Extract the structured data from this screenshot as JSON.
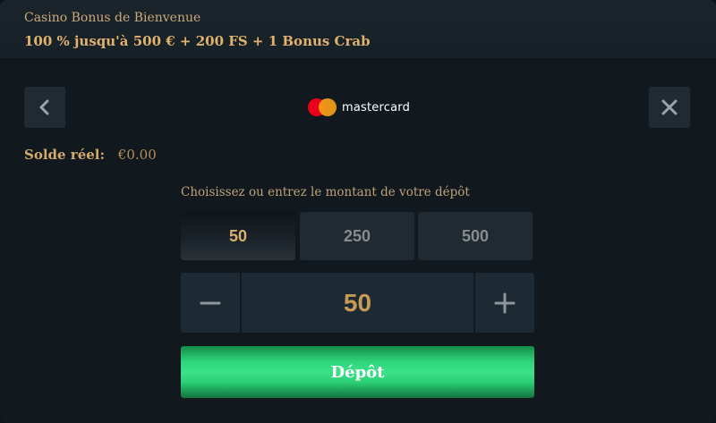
{
  "header": {
    "subtitle": "Casino Bonus de Bienvenue",
    "title": "100 % jusqu'à 500 € + 200 FS + 1 Bonus Crab"
  },
  "nav": {
    "back_icon": "chevron-left-icon",
    "close_icon": "close-icon"
  },
  "provider": {
    "name": "mastercard",
    "logo_icon": "mastercard-logo",
    "colors": {
      "red": "#eb001b",
      "orange": "#f79e1b"
    }
  },
  "balance": {
    "label": "Solde réel:",
    "value": "€0.00"
  },
  "deposit": {
    "instruction": "Choisissez ou entrez le montant de votre dépôt",
    "presets": [
      {
        "label": "50",
        "selected": true
      },
      {
        "label": "250",
        "selected": false
      },
      {
        "label": "500",
        "selected": false
      }
    ],
    "amount": "50",
    "minus_icon": "minus-icon",
    "plus_icon": "plus-icon",
    "button_label": "Dépôt"
  },
  "colors": {
    "accent_gold": "#d9b070",
    "deposit_green": "#2fd57a",
    "panel": "#1f2a33",
    "background": "#12191e"
  }
}
